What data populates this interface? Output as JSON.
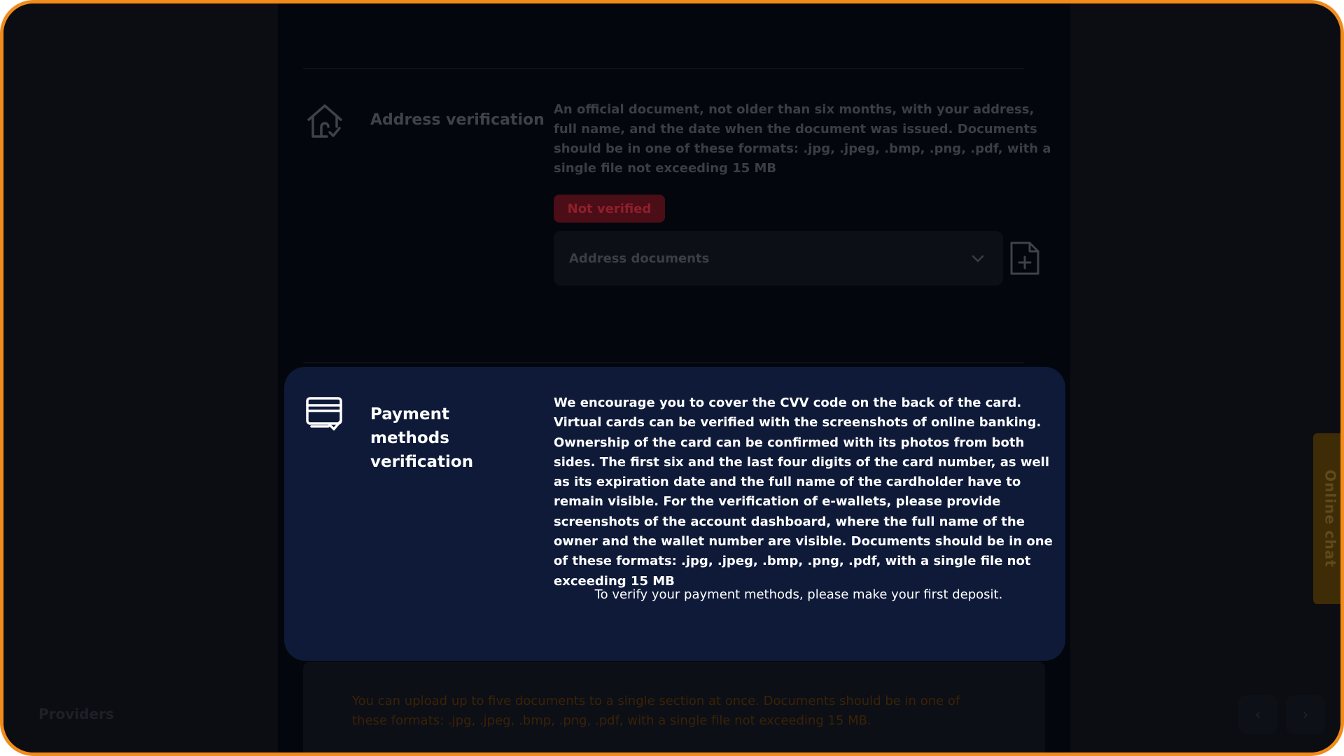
{
  "address": {
    "title": "Address verification",
    "description": "An official document, not older than six months, with your address, full name, and the date when the document was issued. Documents should be in one of these formats: .jpg, .jpeg, .bmp, .png, .pdf, with a single file not exceeding 15 MB",
    "status": "Not verified",
    "select_value": "Address documents",
    "icons": {
      "section": "house-check-icon",
      "dropdown": "chevron-down-icon",
      "upload": "file-add-icon"
    }
  },
  "payment": {
    "title": "Payment methods verification",
    "description": "We encourage you to cover the CVV code on the back of the card. Virtual cards can be verified with the screenshots of online banking. Ownership of the card can be confirmed with its photos from both sides. The first six and the last four digits of the card number, as well as its expiration date and the full name of the cardholder have to remain visible. For the verification of e-wallets, please provide screenshots of the account dashboard, where the full name of the owner and the wallet number are visible. Documents should be in one of these formats: .jpg, .jpeg, .bmp, .png, .pdf, with a single file not exceeding 15 MB",
    "note": "To verify your payment methods, please make your first deposit.",
    "icons": {
      "section": "card-check-icon"
    }
  },
  "info": {
    "text": "You can upload up to five documents to a single section at once. Documents should be in one of these formats: .jpg, .jpeg, .bmp, .png, .pdf, with a single file not exceeding 15 MB."
  },
  "background": {
    "providers_label": "Providers",
    "prev_label": "‹",
    "next_label": "›"
  },
  "chat": {
    "label": "Online chat"
  },
  "colors": {
    "accent_border": "#f28b1a",
    "card_bg": "#0e1a38",
    "badge_bg": "#4b0e16",
    "chat_tab": "#3e2c06"
  }
}
